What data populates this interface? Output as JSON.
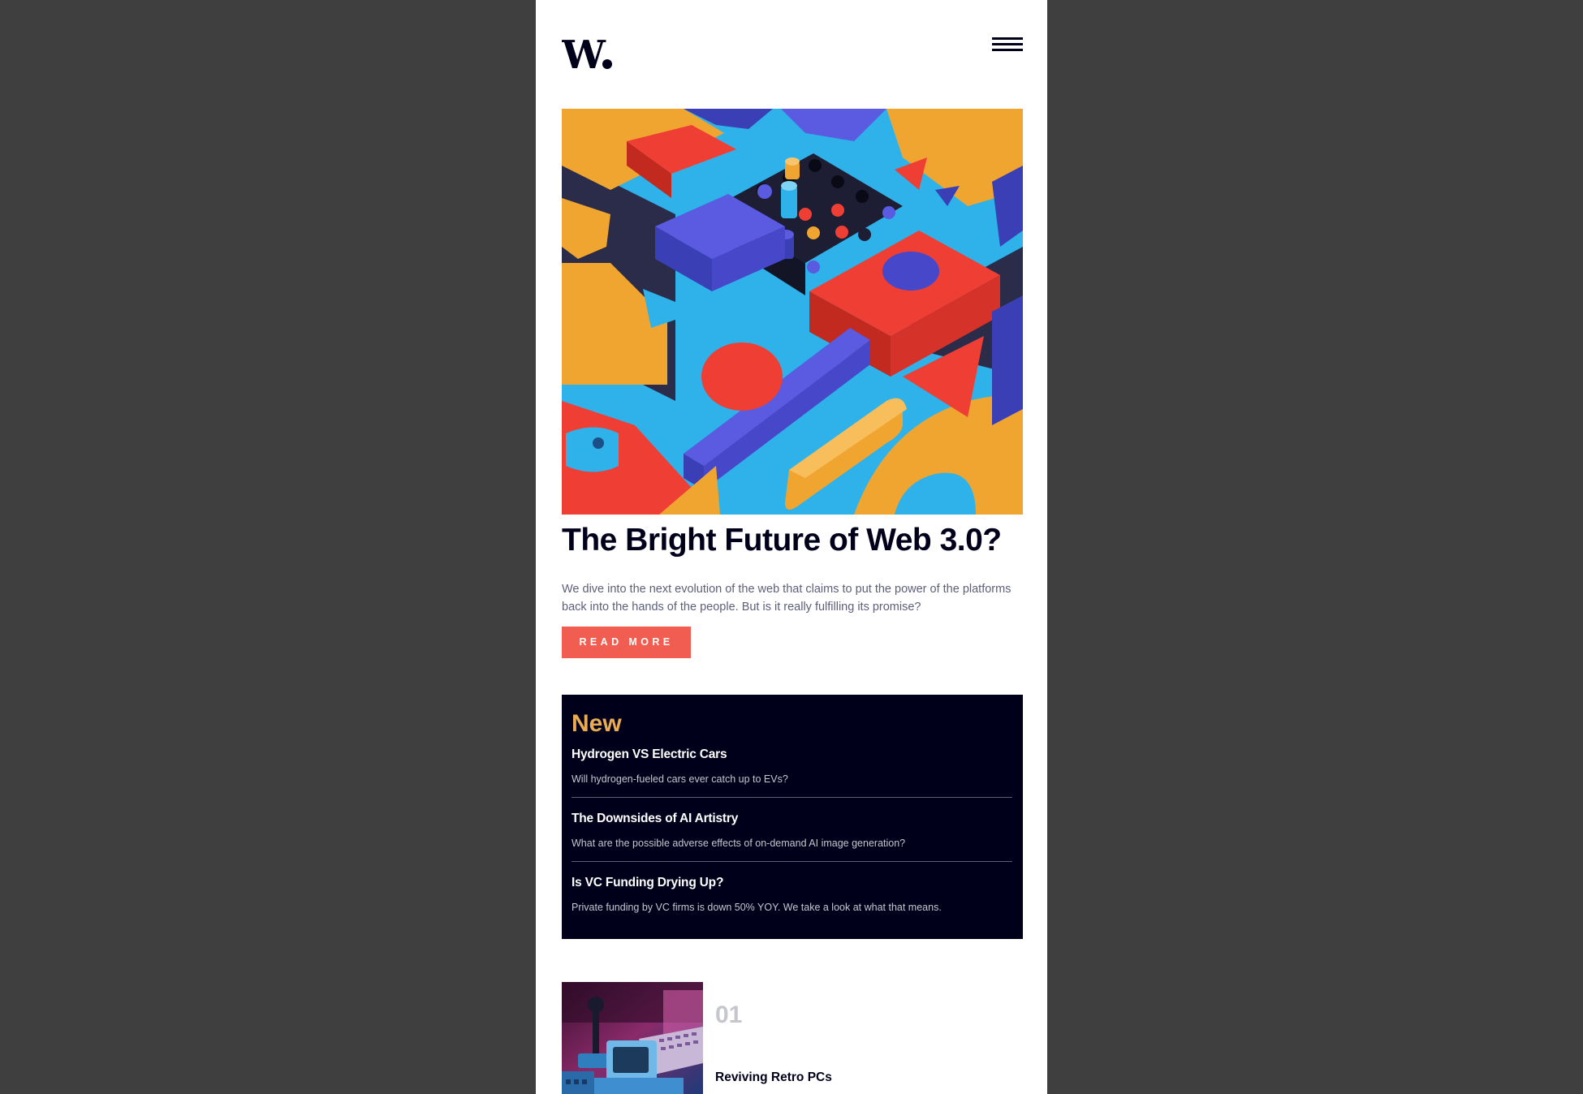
{
  "header": {
    "logo_text": "W.",
    "menu_icon": "hamburger-menu-icon"
  },
  "hero": {
    "image": "abstract-3d-geometric-blocks-illustration",
    "title": "The Bright Future of Web 3.0?",
    "description": "We dive into the next evolution of the web that claims to put the power of the platforms back into the hands of the people. But is it really fulfilling its promise?",
    "button_label": "READ MORE"
  },
  "new_section": {
    "title": "New",
    "items": [
      {
        "title": "Hydrogen VS Electric Cars",
        "description": "Will hydrogen-fueled cars ever catch up to EVs?"
      },
      {
        "title": "The Downsides of AI Artistry",
        "description": "What are the possible adverse effects of on-demand AI image generation?"
      },
      {
        "title": "Is VC Funding Drying Up?",
        "description": "Private funding by VC firms is down 50% YOY. We take a look at what that means."
      }
    ]
  },
  "articles": [
    {
      "number": "01",
      "title": "Reviving Retro PCs",
      "image": "retro-computer-joystick-photo"
    }
  ],
  "colors": {
    "background": "#3f3f3f",
    "page": "#ffffff",
    "dark_navy": "#00001a",
    "accent_red": "#f15d51",
    "accent_orange": "#e9ab53",
    "text_muted": "#5d5f79",
    "text_light": "#c5c6ce"
  }
}
